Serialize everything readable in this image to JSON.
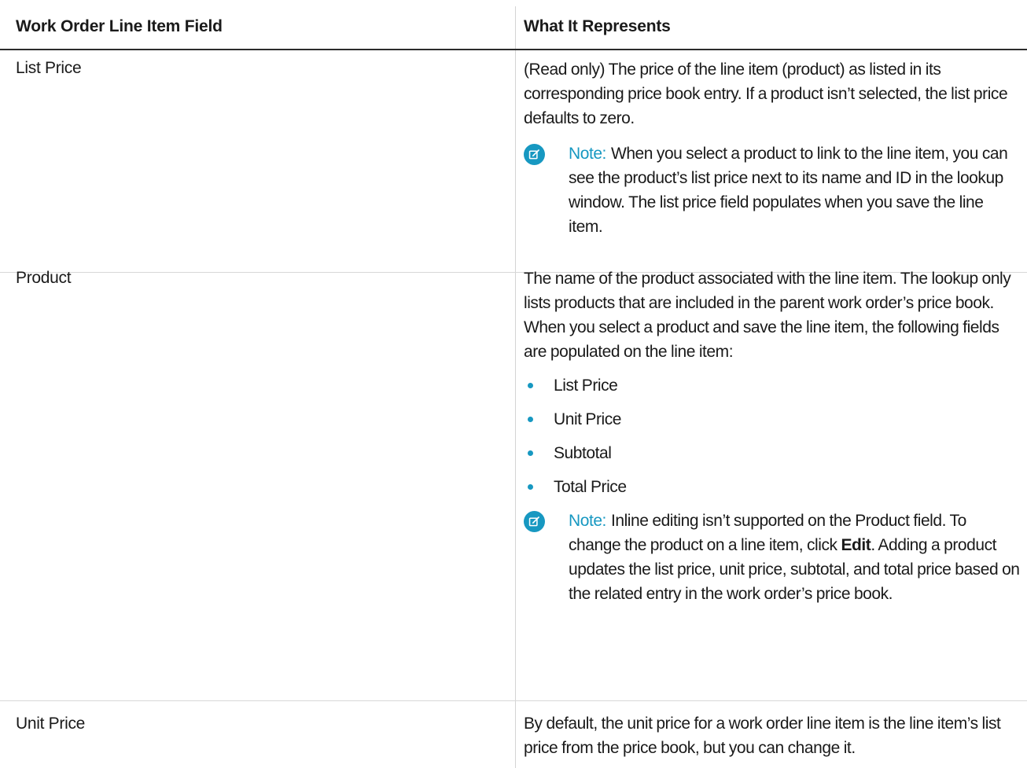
{
  "table": {
    "headers": {
      "field": "Work Order Line Item Field",
      "represents": "What It Represents"
    },
    "rows": [
      {
        "field": "List Price",
        "description": "(Read only) The price of the line item (product) as listed in its corresponding price book entry. If a product isn’t selected, the list price defaults to zero.",
        "note": {
          "label": "Note:",
          "text": "When you select a product to link to the line item, you can see the product’s list price next to its name and ID in the lookup window. The list price field populates when you save the line item."
        }
      },
      {
        "field": "Product",
        "description": "The name of the product associated with the line item. The lookup only lists products that are included in the parent work order’s price book. When you select a product and save the line item, the following fields are populated on the line item:",
        "bullets": [
          "List Price",
          "Unit Price",
          "Subtotal",
          "Total Price"
        ],
        "note": {
          "label": "Note:",
          "text_before": "Inline editing isn’t supported on the Product field. To change the product on a line item, click",
          "bold": "Edit",
          "text_after": ". Adding a product updates the list price, unit price, subtotal, and total price based on the related entry in the work order’s price book."
        }
      },
      {
        "field": "Unit Price",
        "description": "By default, the unit price for a work order line item is the line item’s list price from the price book, but you can change it."
      }
    ]
  },
  "colors": {
    "accent": "#1798c1",
    "text": "#1a1a1a",
    "header_rule": "#2b2b2b",
    "row_rule": "#d8d8d8"
  },
  "icons": {
    "note": "edit-note-icon",
    "bullet": "bullet-dot"
  }
}
